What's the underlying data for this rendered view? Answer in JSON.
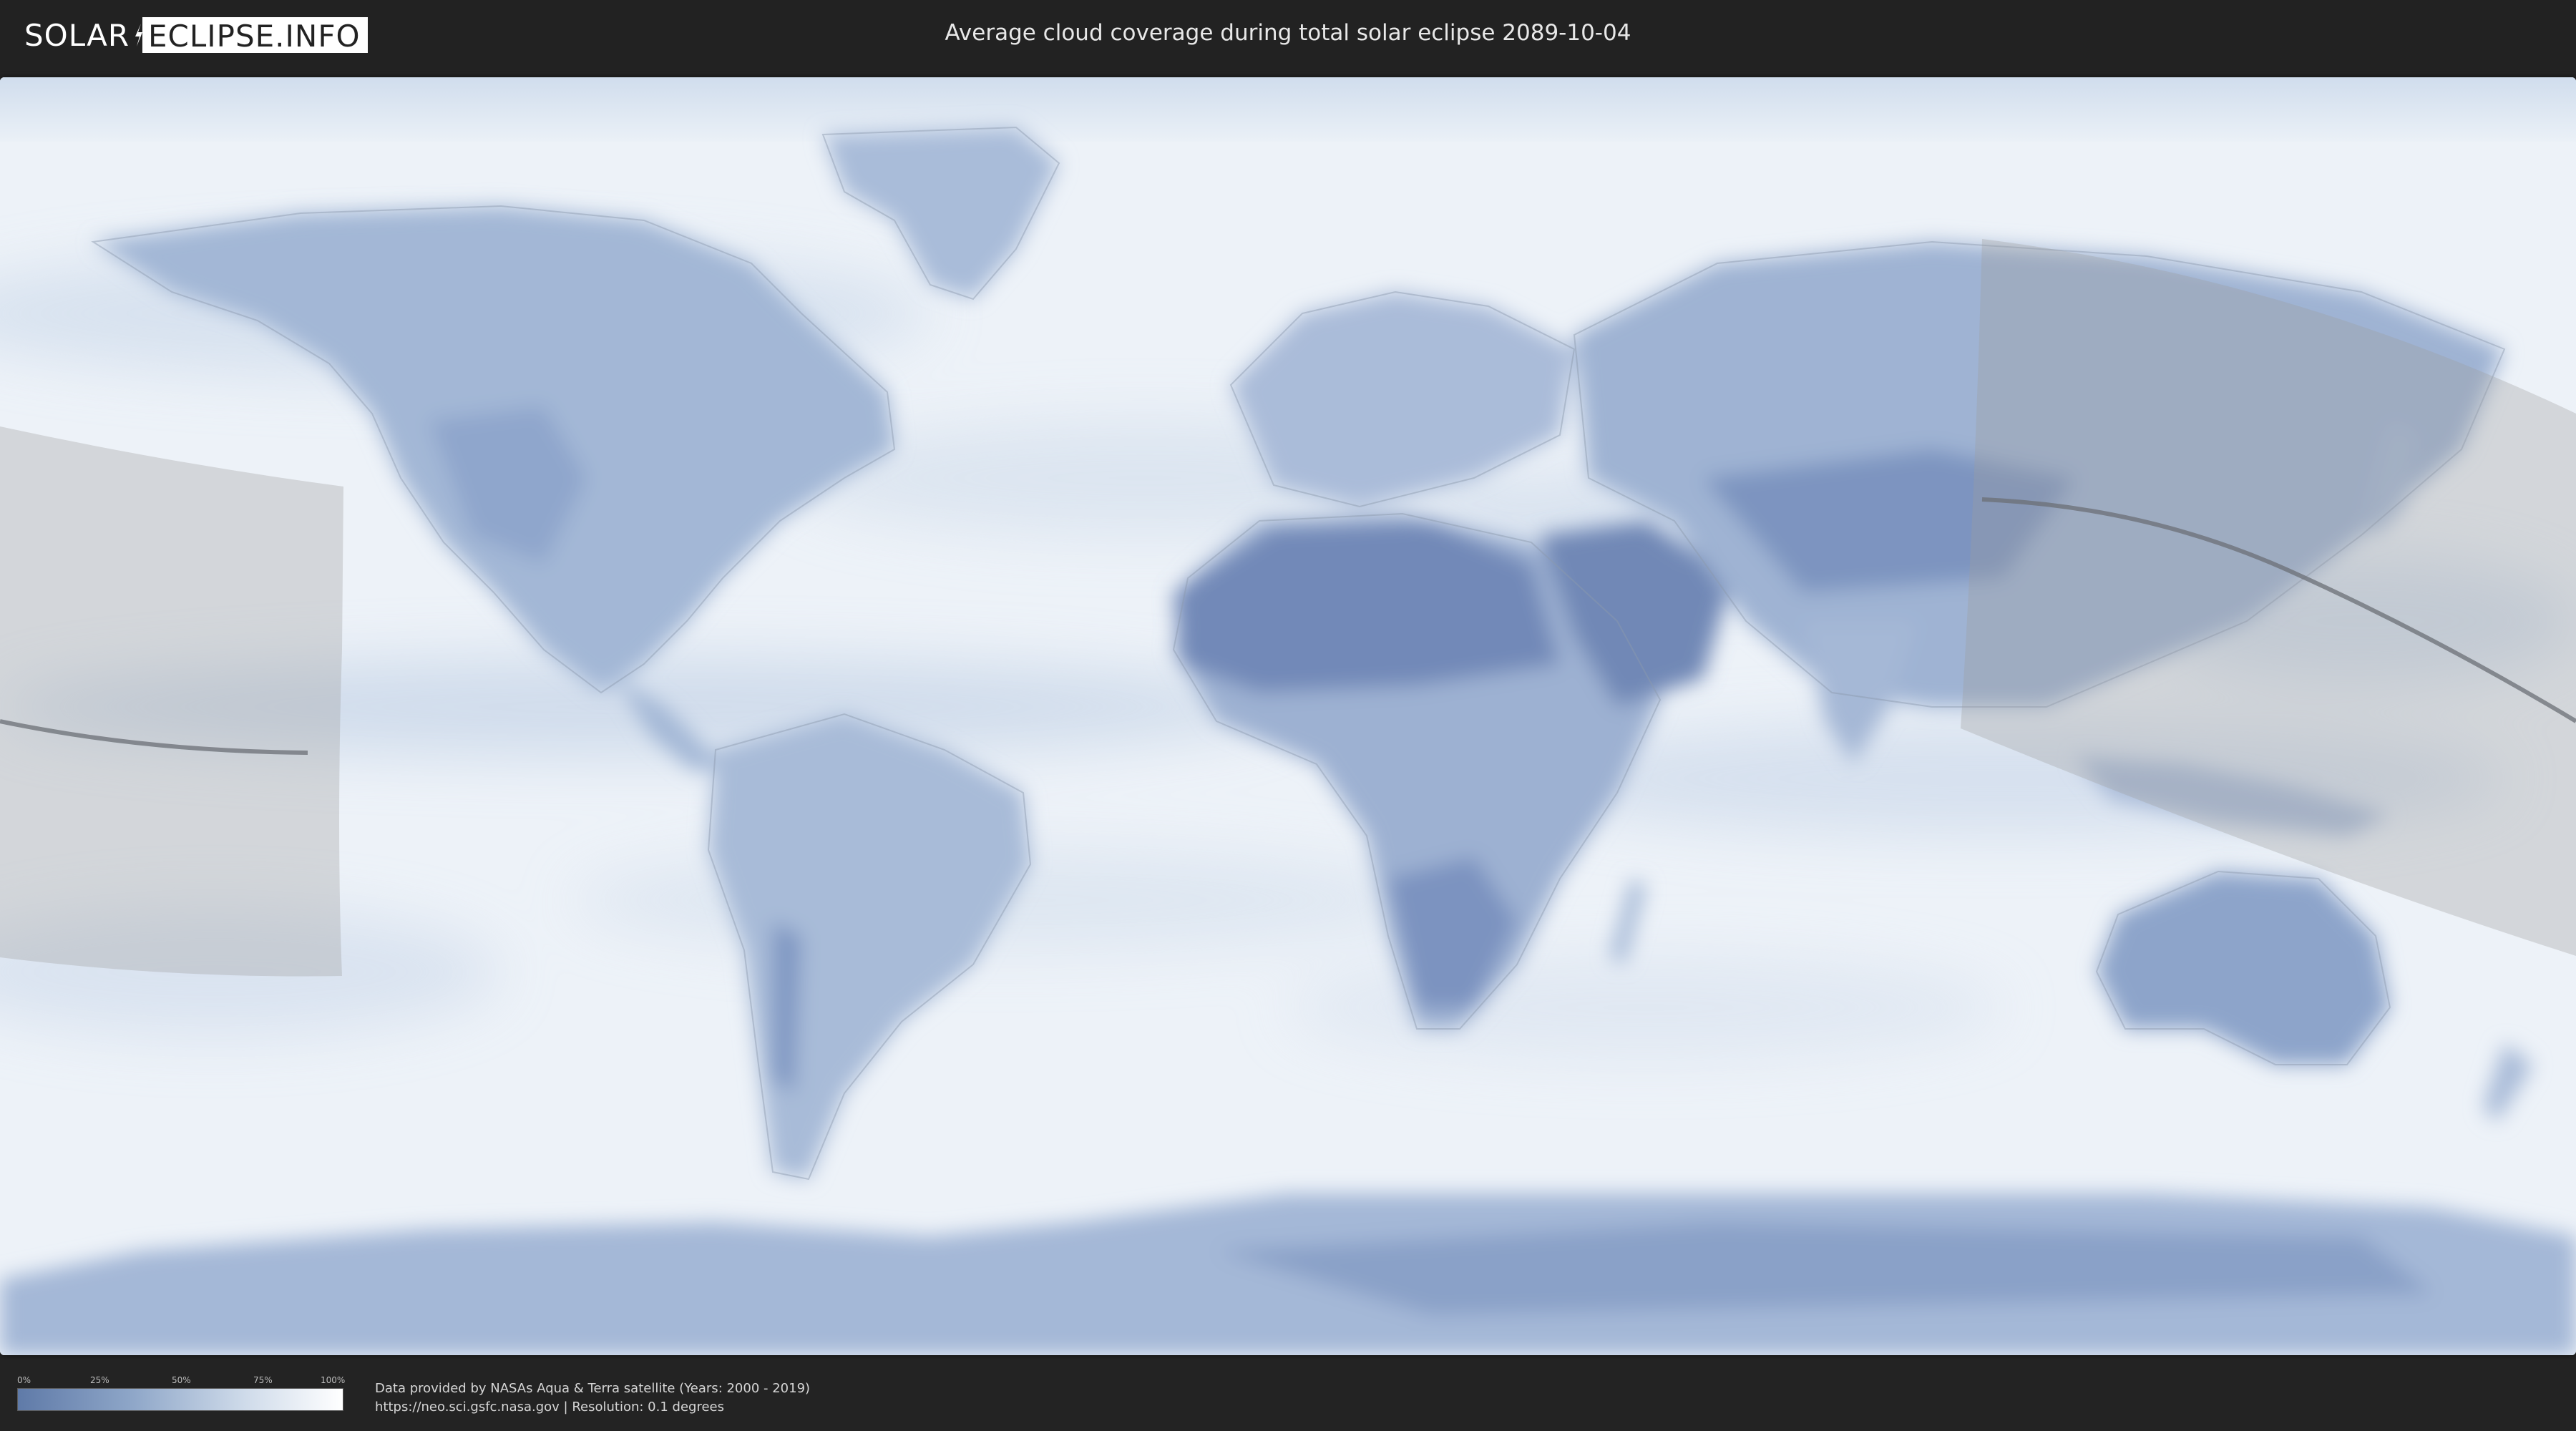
{
  "header": {
    "logo_left": "SOLAR",
    "logo_right": "ECLIPSE.INFO",
    "title": "Average cloud coverage during total solar eclipse 2089-10-04"
  },
  "legend": {
    "ticks": [
      "0%",
      "25%",
      "50%",
      "75%",
      "100%"
    ],
    "colors": [
      "#5f7aa8",
      "#8ea6c8",
      "#cfdbea",
      "#ffffff"
    ]
  },
  "credits": {
    "line1": "Data provided by NASAs Aqua & Terra satellite (Years: 2000 - 2019)",
    "line2": "https://neo.sci.gsfc.nasa.gov | Resolution: 0.1 degrees"
  },
  "map": {
    "ocean_color": "#e9eff6",
    "land_color": "#9fb3d3",
    "dry_land_color": "#7188b6",
    "eclipse_shadow_color": "#a8a8a8",
    "center_line_color": "#6b6f75"
  }
}
